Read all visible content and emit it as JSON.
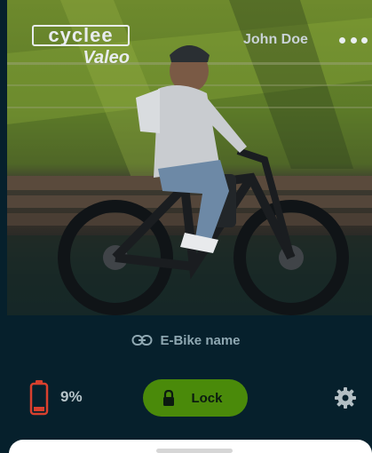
{
  "header": {
    "logo_top": "cyclee",
    "logo_bottom": "Valeo",
    "user_name": "John Doe",
    "menu_icon": "more-dots-icon"
  },
  "bike": {
    "name": "E-Bike name",
    "link_icon": "link-icon"
  },
  "status": {
    "battery_percent": "9%",
    "battery_level": 0.09,
    "battery_color": "#d8402e",
    "lock_label": "Lock",
    "lock_color": "#4a8a0a",
    "settings_icon": "gear-icon"
  },
  "colors": {
    "background": "#06202c",
    "accent_green": "#4a8a0a"
  }
}
